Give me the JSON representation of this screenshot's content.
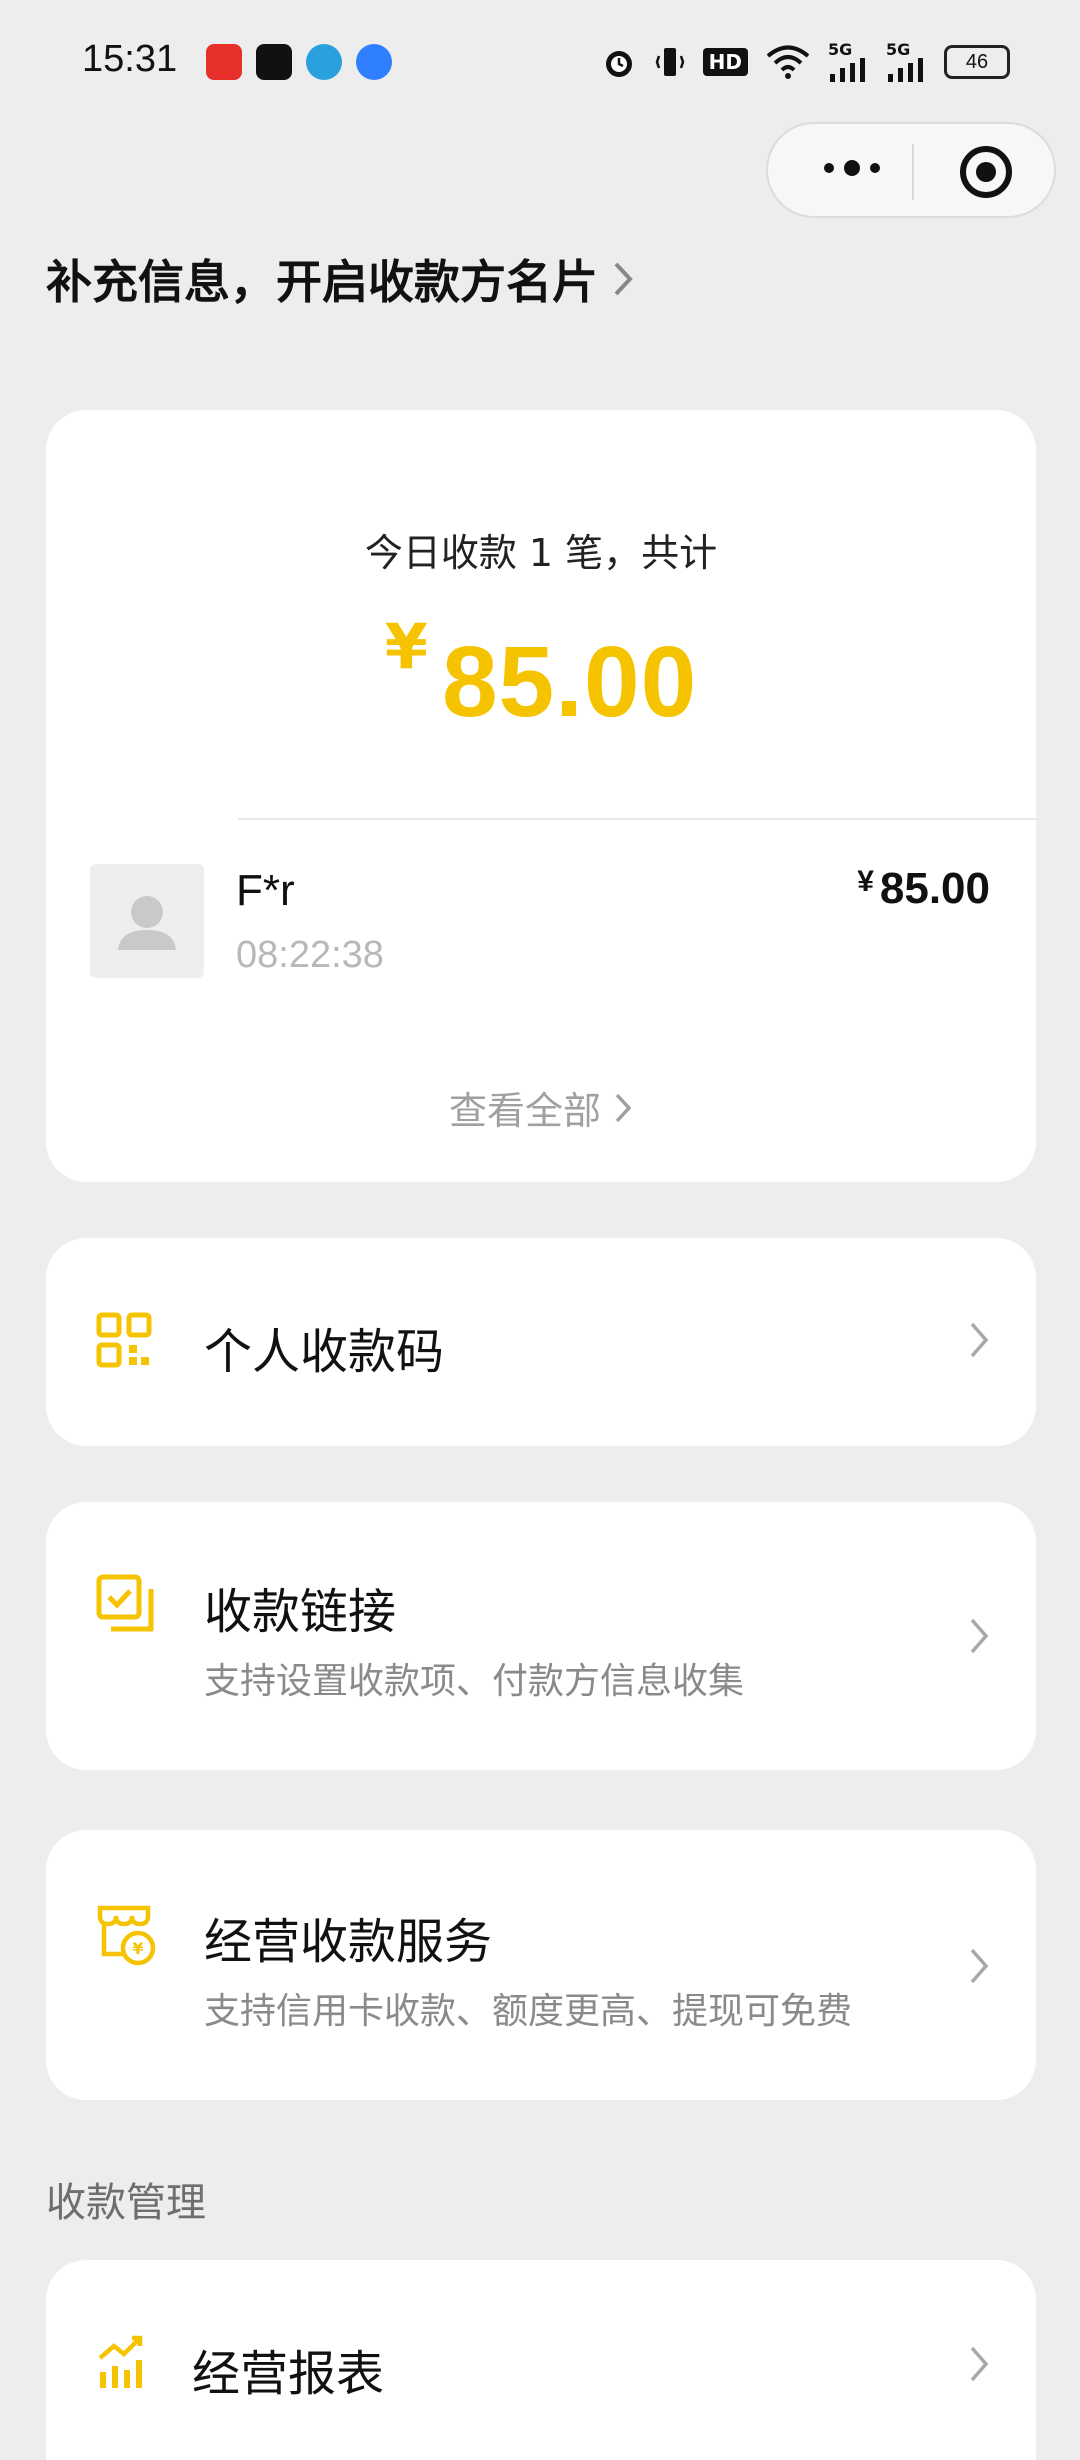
{
  "status_bar": {
    "time": "15:31",
    "notif_icons": [
      "toutiao-icon",
      "douyin-icon",
      "telegram-icon",
      "browser-icon"
    ],
    "notif_colors": [
      "#e8302b",
      "#111111",
      "#2aa1de",
      "#2f7fff"
    ],
    "hd_label": "HD",
    "signal_label_1": "5G",
    "signal_label_2": "5G",
    "battery": "46"
  },
  "header": {
    "link_text": "补充信息，开启收款方名片"
  },
  "summary": {
    "text": "今日收款 1 笔，共计",
    "currency": "¥",
    "amount": "85.00",
    "accent": "#f6c300"
  },
  "transaction": {
    "name": "F*r",
    "time": "08:22:38",
    "currency": "¥",
    "amount": "85.00"
  },
  "view_all": "查看全部",
  "menu": {
    "qr": {
      "title": "个人收款码",
      "icon": "qr-code-icon"
    },
    "link": {
      "title": "收款链接",
      "subtitle": "支持设置收款项、付款方信息收集",
      "icon": "payment-link-icon"
    },
    "biz": {
      "title": "经营收款服务",
      "subtitle": "支持信用卡收款、额度更高、提现可免费",
      "icon": "store-payment-icon"
    }
  },
  "section": {
    "title": "收款管理",
    "report_title": "经营报表",
    "report_icon": "chart-up-icon"
  }
}
